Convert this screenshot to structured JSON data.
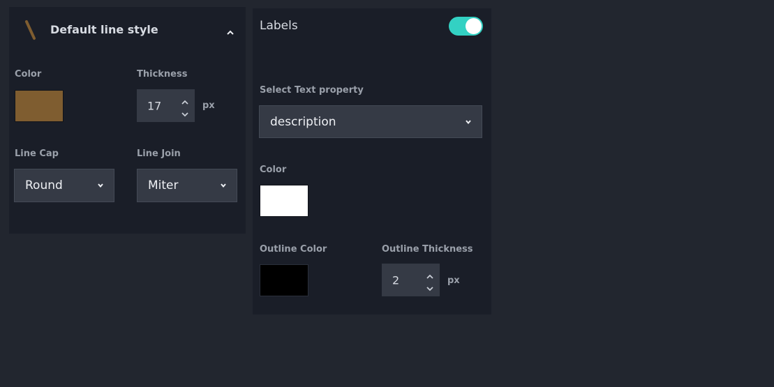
{
  "line_style": {
    "title": "Default line style",
    "color_label": "Color",
    "color_value": "#7f5d30",
    "thickness_label": "Thickness",
    "thickness_value": "17",
    "thickness_unit": "px",
    "line_cap_label": "Line Cap",
    "line_cap_value": "Round",
    "line_join_label": "Line Join",
    "line_join_value": "Miter",
    "collapse_icon": "chevron-up-icon",
    "header_icon": "line-icon"
  },
  "labels": {
    "title": "Labels",
    "enabled": true,
    "toggle_color": "#33d1c3",
    "text_property_label": "Select Text property",
    "text_property_value": "description",
    "color_label": "Color",
    "color_value": "#ffffff",
    "outline_color_label": "Outline Color",
    "outline_color_value": "#000000",
    "outline_thickness_label": "Outline Thickness",
    "outline_thickness_value": "2",
    "outline_thickness_unit": "px"
  }
}
